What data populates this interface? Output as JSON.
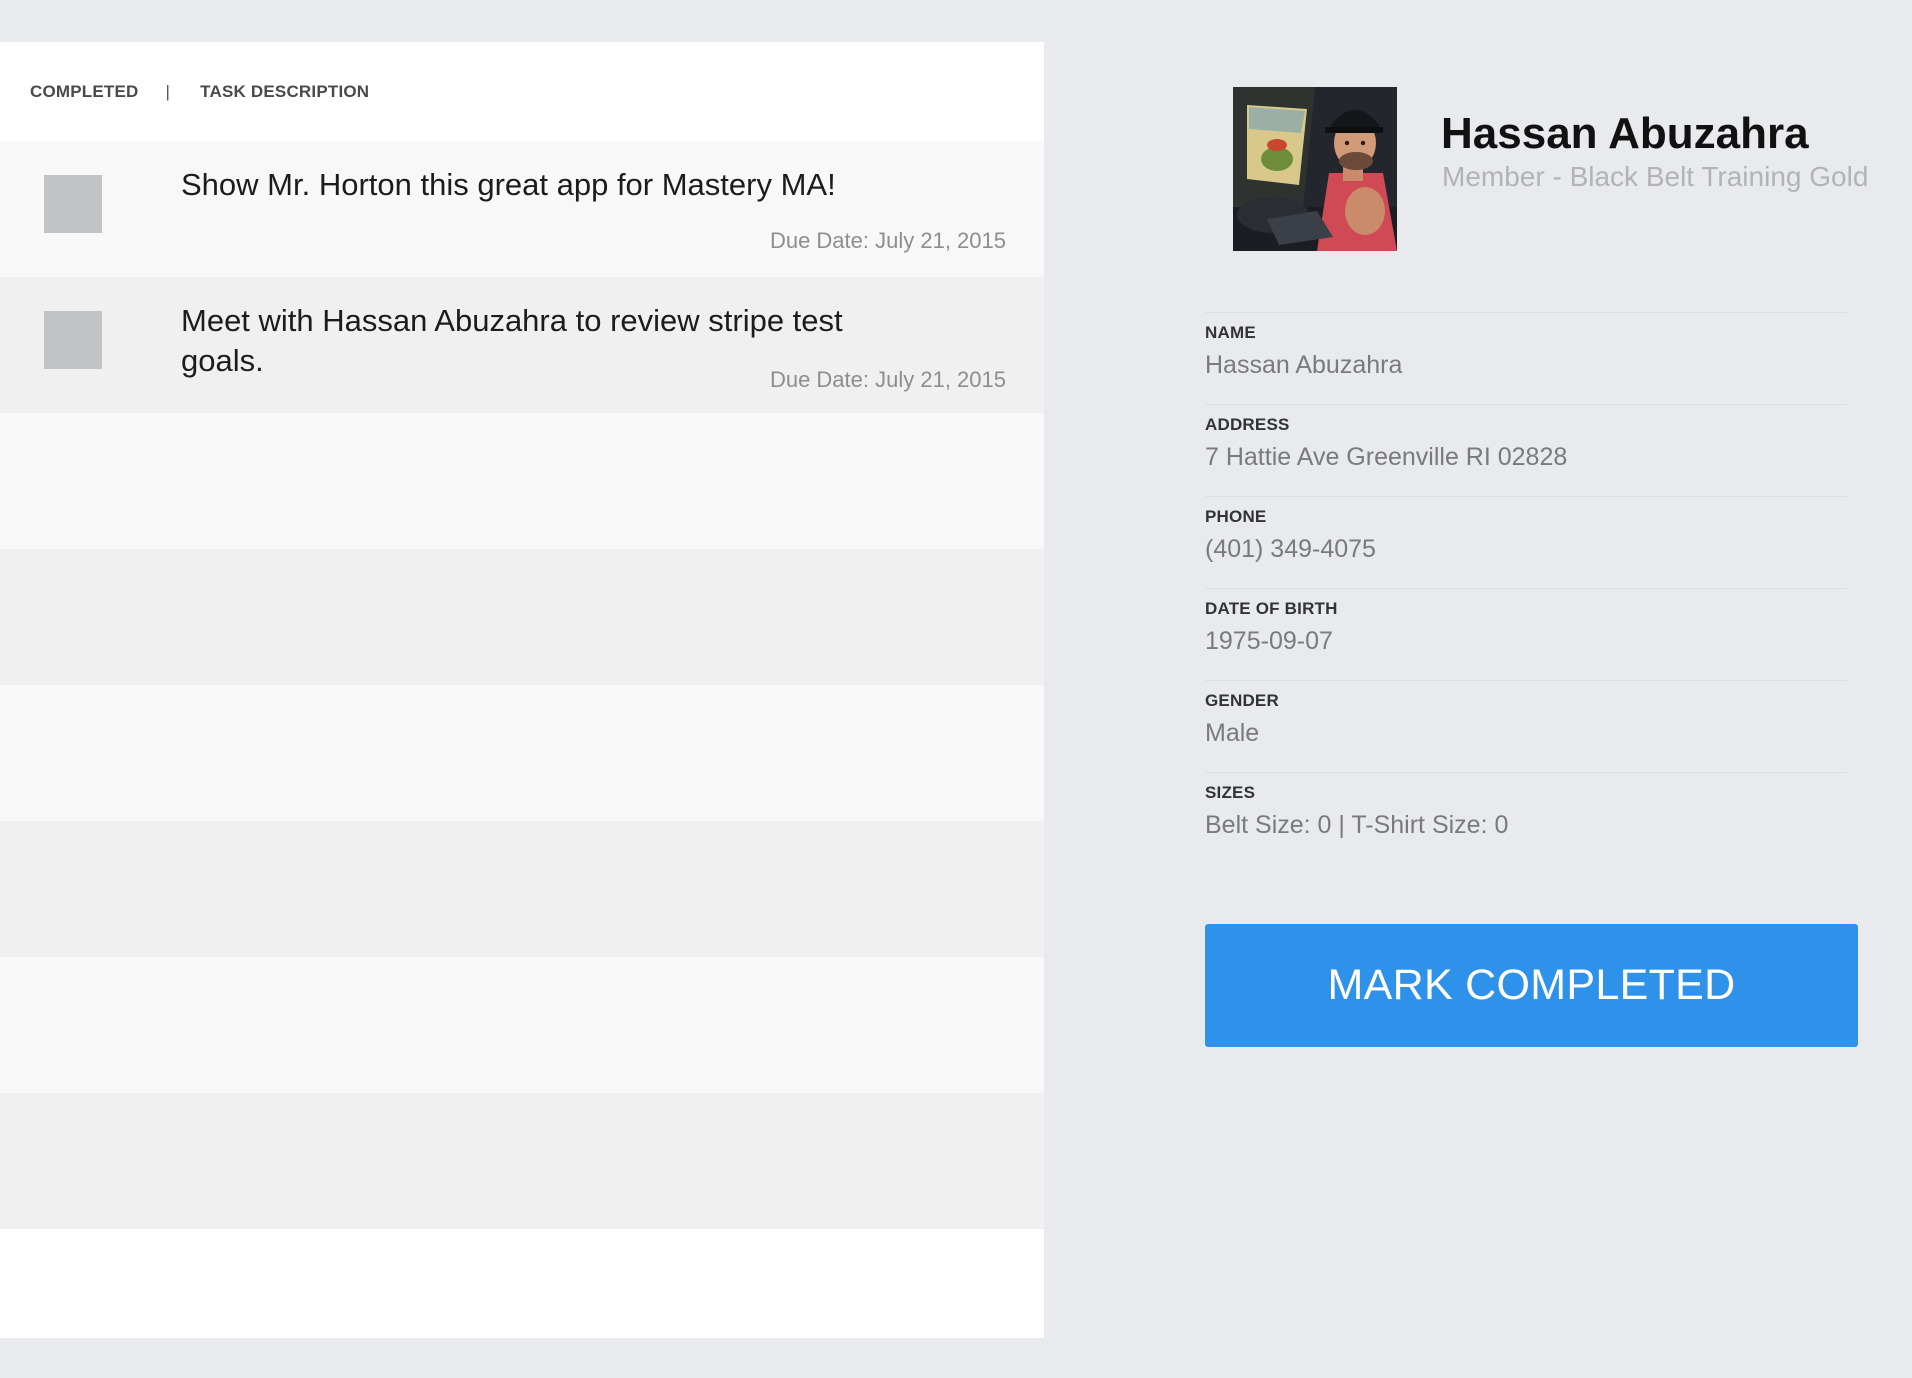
{
  "tasks": {
    "header": {
      "completed_label": "COMPLETED",
      "separator": "|",
      "description_label": "TASK DESCRIPTION"
    },
    "items": [
      {
        "description": "Show Mr. Horton this great app for Mastery MA!",
        "due_date": "Due Date: July 21, 2015",
        "completed": false
      },
      {
        "description": "Meet with Hassan Abuzahra to review stripe test goals.",
        "due_date": "Due Date: July 21, 2015",
        "completed": false
      }
    ]
  },
  "profile": {
    "name": "Hassan Abuzahra",
    "subtitle": "Member - Black Belt Training Gold",
    "fields": [
      {
        "label": "NAME",
        "value": "Hassan Abuzahra"
      },
      {
        "label": "ADDRESS",
        "value": "7 Hattie Ave Greenville RI 02828"
      },
      {
        "label": "PHONE",
        "value": "(401) 349-4075"
      },
      {
        "label": "DATE OF BIRTH",
        "value": "1975-09-07"
      },
      {
        "label": "GENDER",
        "value": "Male"
      },
      {
        "label": "SIZES",
        "value": "Belt Size: 0 | T-Shirt Size: 0"
      }
    ]
  },
  "actions": {
    "mark_completed_label": "MARK COMPLETED"
  },
  "colors": {
    "page_background": "#e9eaed",
    "accent_button": "#2f92ea",
    "checkbox": "#c2c3c5",
    "row_light": "#f8f8f8",
    "row_dark": "#f0f0f0"
  }
}
